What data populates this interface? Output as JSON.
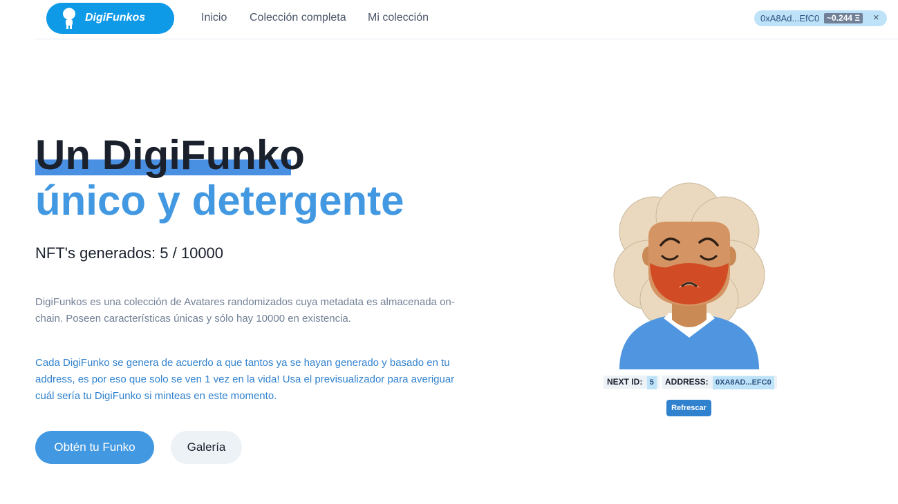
{
  "header": {
    "brand": "DigiFunkos",
    "nav": [
      "Inicio",
      "Colección completa",
      "Mi colección"
    ],
    "wallet": {
      "address": "0xA8Ad...EfC0",
      "balance": "~0.244 Ξ",
      "close_icon": "×"
    }
  },
  "hero": {
    "title_line1": "Un DigiFunko",
    "title_line2": "único y detergente",
    "counter": "NFT's generados: 5 / 10000",
    "description": "DigiFunkos es una colección de Avatares randomizados cuya metadata es almacenada on-chain. Poseen características únicas y sólo hay 10000 en existencia.",
    "description2": "Cada DigiFunko se genera de acuerdo a que tantos ya se hayan generado y basado en tu address, es por eso que solo se ven 1 vez en la vida! Usa el previsualizador para averiguar cuál sería tu DigiFunko si minteas en este momento.",
    "primary_button": "Obtén tu Funko",
    "secondary_button": "Galería"
  },
  "preview": {
    "next_id_label": "NEXT ID:",
    "next_id_value": "5",
    "address_label": "ADDRESS:",
    "address_value": "0XA8AD...EFC0",
    "refresh_button": "Refrescar"
  },
  "colors": {
    "brand": "#0f9ae8",
    "accent": "#4299e1",
    "heading": "#1a202c"
  }
}
